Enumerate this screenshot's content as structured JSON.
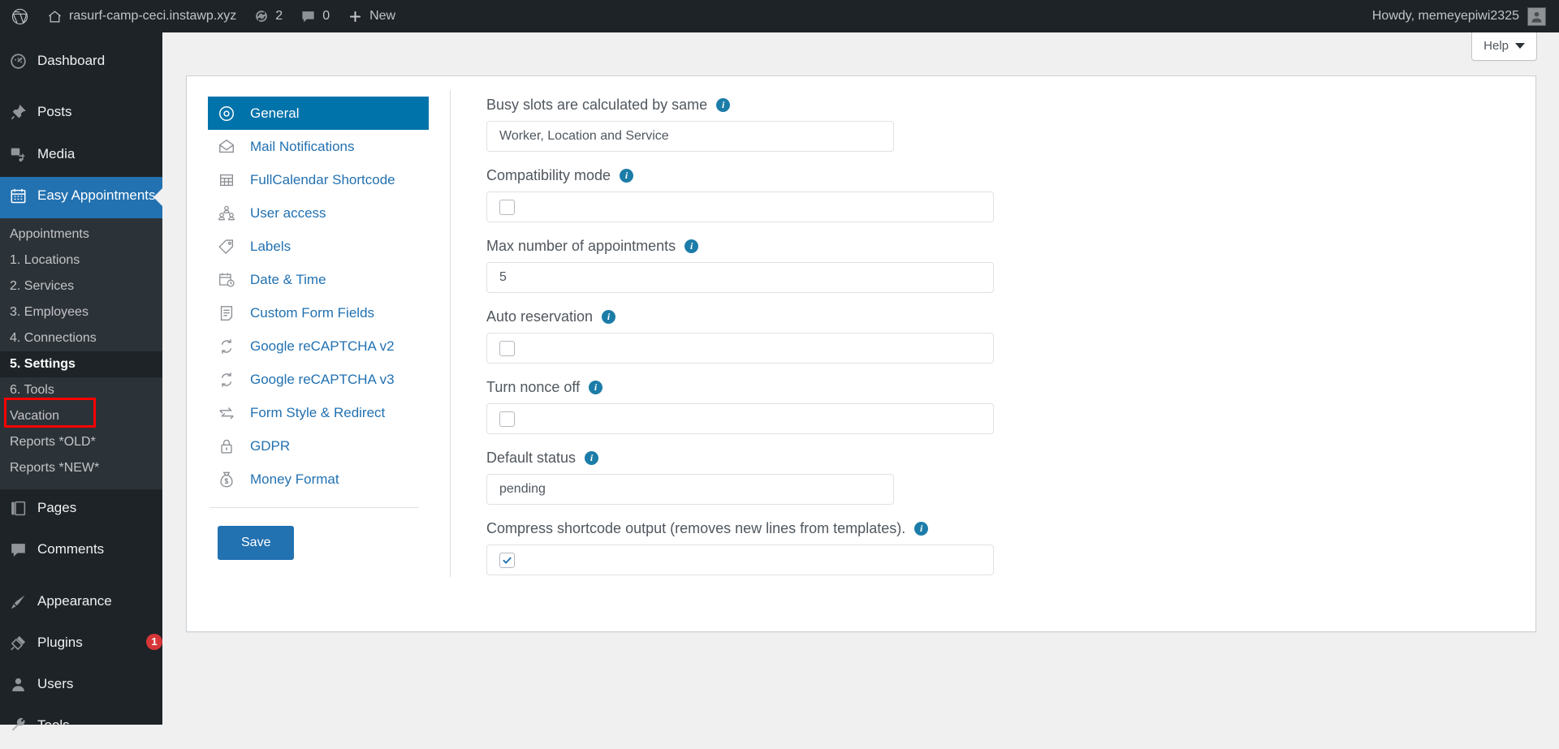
{
  "adminbar": {
    "wp_logo": "wordpress-icon",
    "site_name": "rasurf-camp-ceci.instawp.xyz",
    "home_icon": "home-icon",
    "updates_icon": "updates-icon",
    "updates_count": "2",
    "comments_icon": "comment-bubble-icon",
    "comments_count": "0",
    "new_icon": "plus-icon",
    "new_label": "New",
    "howdy": "Howdy, memeyepiwi2325",
    "avatar_icon": "user-avatar-icon"
  },
  "sidebar": {
    "top_items": [
      {
        "label": "Dashboard",
        "icon": "dashboard-icon"
      },
      {
        "label": "Posts",
        "icon": "pin-icon"
      },
      {
        "label": "Media",
        "icon": "media-icon"
      },
      {
        "label": "Easy Appointments",
        "icon": "calendar-icon",
        "current": true
      }
    ],
    "submenu": [
      {
        "label": "Appointments"
      },
      {
        "label": "1. Locations"
      },
      {
        "label": "2. Services"
      },
      {
        "label": "3. Employees"
      },
      {
        "label": "4. Connections"
      },
      {
        "label": "5. Settings",
        "highlighted": true
      },
      {
        "label": "6. Tools"
      },
      {
        "label": "Vacation"
      },
      {
        "label": "Reports *OLD*"
      },
      {
        "label": "Reports *NEW*"
      }
    ],
    "bottom_items": [
      {
        "label": "Pages",
        "icon": "pages-icon"
      },
      {
        "label": "Comments",
        "icon": "comment-bubble-icon"
      },
      {
        "label": "Appearance",
        "icon": "brush-icon"
      },
      {
        "label": "Plugins",
        "icon": "plug-icon",
        "badge": "1"
      },
      {
        "label": "Users",
        "icon": "user-icon"
      },
      {
        "label": "Tools",
        "icon": "wrench-icon"
      }
    ],
    "highlight_color": "#ff0000",
    "current_color": "#2271b1"
  },
  "help": {
    "label": "Help",
    "caret_icon": "chevron-down-icon"
  },
  "settings_tabs": [
    {
      "label": "General",
      "icon": "target-icon",
      "active": true
    },
    {
      "label": "Mail Notifications",
      "icon": "envelope-icon"
    },
    {
      "label": "FullCalendar Shortcode",
      "icon": "table-icon"
    },
    {
      "label": "User access",
      "icon": "users-group-icon"
    },
    {
      "label": "Labels",
      "icon": "tag-icon"
    },
    {
      "label": "Date & Time",
      "icon": "calendar-clock-icon"
    },
    {
      "label": "Custom Form Fields",
      "icon": "document-icon"
    },
    {
      "label": "Google reCAPTCHA v2",
      "icon": "recaptcha-icon"
    },
    {
      "label": "Google reCAPTCHA v3",
      "icon": "recaptcha-icon"
    },
    {
      "label": "Form Style & Redirect",
      "icon": "arrows-exchange-icon"
    },
    {
      "label": "GDPR",
      "icon": "lock-icon"
    },
    {
      "label": "Money Format",
      "icon": "money-bag-icon"
    }
  ],
  "save_button": {
    "label": "Save",
    "color": "#2271b1"
  },
  "form": {
    "fields": [
      {
        "label": "Busy slots are calculated by same",
        "info_icon": "info-icon",
        "type": "select",
        "value": "Worker, Location and Service",
        "width": "narrow"
      },
      {
        "label": "Compatibility mode",
        "info_icon": "info-icon",
        "type": "checkbox",
        "checked": false,
        "width": "wide"
      },
      {
        "label": "Max number of appointments",
        "info_icon": "info-icon",
        "type": "text",
        "value": "5",
        "width": "wide"
      },
      {
        "label": "Auto reservation",
        "info_icon": "info-icon",
        "type": "checkbox",
        "checked": false,
        "width": "wide"
      },
      {
        "label": "Turn nonce off",
        "info_icon": "info-icon",
        "type": "checkbox",
        "checked": false,
        "width": "wide"
      },
      {
        "label": "Default status",
        "info_icon": "info-icon",
        "type": "select",
        "value": "pending",
        "width": "narrow"
      },
      {
        "label": "Compress shortcode output (removes new lines from templates).",
        "info_icon": "info-icon",
        "type": "checkbox",
        "checked": true,
        "width": "wide"
      }
    ]
  }
}
